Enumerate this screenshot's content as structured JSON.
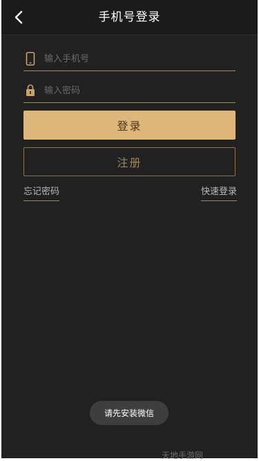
{
  "header": {
    "title": "手机号登录",
    "back_icon": "chevron-left-icon"
  },
  "form": {
    "phone": {
      "placeholder": "输入手机号",
      "value": "",
      "icon": "phone-icon"
    },
    "password": {
      "placeholder": "输入密码",
      "value": "",
      "icon": "lock-icon"
    },
    "login_label": "登录",
    "register_label": "注册",
    "forgot_label": "忘记密码",
    "quick_login_label": "快速登录"
  },
  "toast": {
    "message": "请先安装微信"
  },
  "watermark": {
    "text": "天地手游网"
  },
  "colors": {
    "background": "#212121",
    "header": "#1b1b1b",
    "accent": "#dcb67a",
    "accent_text": "#4a3518",
    "outline": "#8a7550"
  }
}
